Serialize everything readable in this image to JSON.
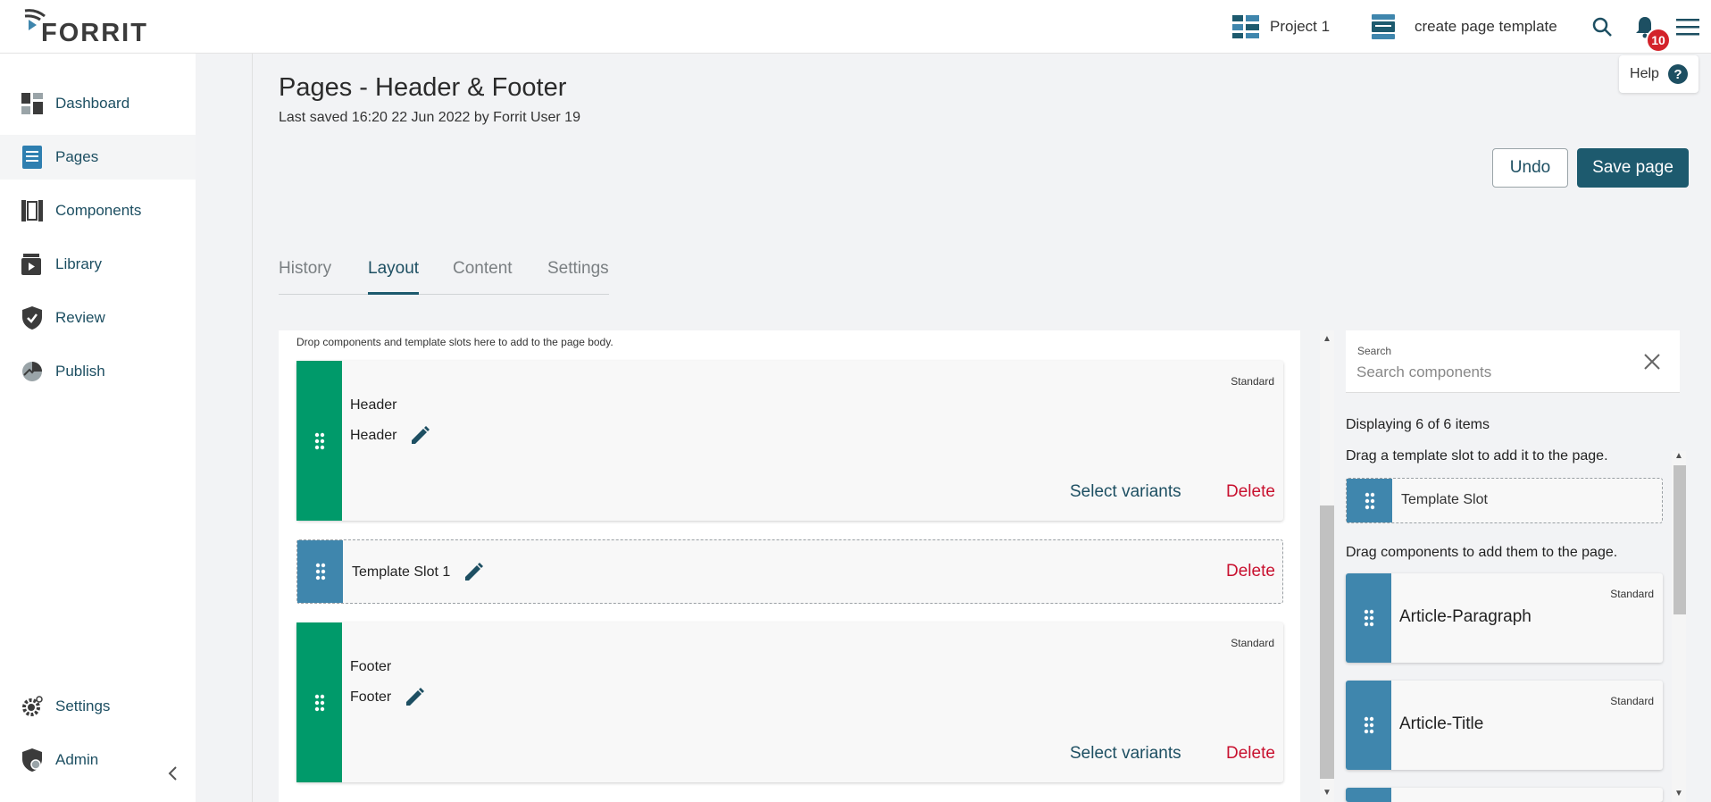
{
  "app": {
    "logo_text": "FORRIT"
  },
  "topbar": {
    "project_label": "Project 1",
    "template_label": "create page template",
    "notification_count": "10"
  },
  "help": {
    "label": "Help",
    "icon_glyph": "?"
  },
  "sidebar": {
    "items": [
      {
        "label": "Dashboard",
        "icon": "dashboard-icon"
      },
      {
        "label": "Pages",
        "icon": "pages-icon",
        "active": true
      },
      {
        "label": "Components",
        "icon": "components-icon"
      },
      {
        "label": "Library",
        "icon": "library-icon"
      },
      {
        "label": "Review",
        "icon": "review-icon"
      },
      {
        "label": "Publish",
        "icon": "publish-icon"
      }
    ],
    "bottom_items": [
      {
        "label": "Settings",
        "icon": "settings-icon"
      },
      {
        "label": "Admin",
        "icon": "admin-icon"
      }
    ]
  },
  "page": {
    "title": "Pages - Header & Footer",
    "last_saved": "Last saved 16:20 22 Jun 2022 by Forrit User 19",
    "undo_label": "Undo",
    "save_label": "Save page"
  },
  "tabs": [
    {
      "label": "History"
    },
    {
      "label": "Layout",
      "active": true
    },
    {
      "label": "Content"
    },
    {
      "label": "Settings"
    }
  ],
  "canvas": {
    "hint": "Drop components and template slots here to add to the page body.",
    "cards": [
      {
        "type": "component",
        "tag": "Standard",
        "name": "Header",
        "instance": "Header",
        "select_label": "Select variants",
        "delete_label": "Delete"
      },
      {
        "type": "slot",
        "name": "Template Slot 1",
        "delete_label": "Delete"
      },
      {
        "type": "component",
        "tag": "Standard",
        "name": "Footer",
        "instance": "Footer",
        "select_label": "Select variants",
        "delete_label": "Delete"
      }
    ]
  },
  "panel": {
    "search_label": "Search",
    "search_placeholder": "Search components",
    "search_value": "",
    "display_count": "Displaying 6 of 6 items",
    "slot_hint": "Drag a template slot to add it to the page.",
    "slot_item": "Template Slot",
    "component_hint": "Drag components to add them to the page.",
    "components": [
      {
        "label": "Article-Paragraph",
        "tag": "Standard"
      },
      {
        "label": "Article-Title",
        "tag": "Standard"
      }
    ]
  },
  "colors": {
    "primary": "#1d5a6e",
    "component_handle": "#009a6a",
    "slot_handle": "#3f86ad",
    "delete": "#c8102e",
    "badge": "#d3222a"
  }
}
